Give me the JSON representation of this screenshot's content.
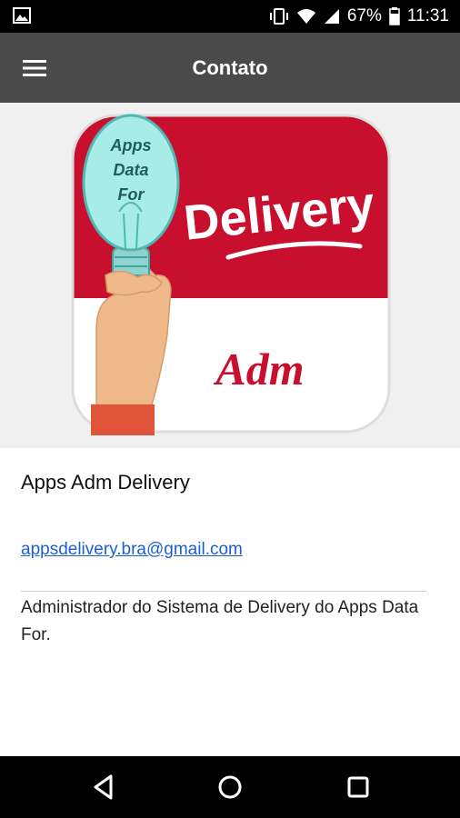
{
  "status_bar": {
    "battery": "67%",
    "time": "11:31",
    "icons": [
      "image-icon",
      "vibrate-icon",
      "wifi-icon",
      "signal-icon",
      "battery-icon"
    ]
  },
  "app_bar": {
    "title": "Contato",
    "menu_icon": "hamburger-menu-icon"
  },
  "logo": {
    "bulb_text_1": "Apps",
    "bulb_text_2": "Data",
    "bulb_text_3": "For",
    "delivery_text": "Delivery",
    "adm_text": "Adm",
    "colors": {
      "red": "#c8102e",
      "white": "#ffffff",
      "bulb": "#8fe0dc",
      "skin": "#f0b98a"
    }
  },
  "contact": {
    "app_name": "Apps Adm Delivery",
    "email": "appsdelivery.bra@gmail.com",
    "description": "Administrador do Sistema de Delivery do Apps Data For."
  },
  "nav_bar": {
    "back_icon": "back-triangle-icon",
    "home_icon": "home-circle-icon",
    "recents_icon": "recents-square-icon"
  }
}
